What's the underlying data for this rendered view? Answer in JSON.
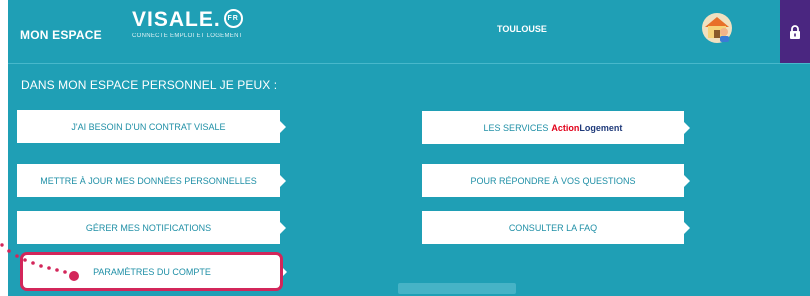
{
  "header": {
    "brand_label": "MON ESPACE",
    "logo_text": "VISALE.",
    "logo_badge": "FR",
    "logo_tagline": "CONNECTE EMPLOI ET LOGEMENT",
    "city": "TOULOUSE"
  },
  "main": {
    "section_title": "DANS MON ESPACE PERSONNEL JE PEUX :",
    "left_actions": [
      {
        "label": "J'AI BESOIN D'UN CONTRAT VISALE"
      },
      {
        "label": "METTRE À JOUR MES DONNÉES PERSONNELLES"
      },
      {
        "label": "GÉRER MES NOTIFICATIONS"
      },
      {
        "label": "PARAMÈTRES DU COMPTE"
      }
    ],
    "right_actions": [
      {
        "label": "LES SERVICES",
        "partner_part1": "Action",
        "partner_part2": "Logement"
      },
      {
        "label": "POUR RÉPONDRE À VOS QUESTIONS"
      },
      {
        "label": "CONSULTER LA FAQ"
      }
    ]
  },
  "colors": {
    "panel": "#1f9fb5",
    "button_text": "#1f8fa6",
    "lock_button": "#4a2680",
    "highlight": "#d3265a"
  },
  "icons": [
    "house-user-icon",
    "lock-icon",
    "fr-badge-icon",
    "arrow-tab-icon"
  ]
}
